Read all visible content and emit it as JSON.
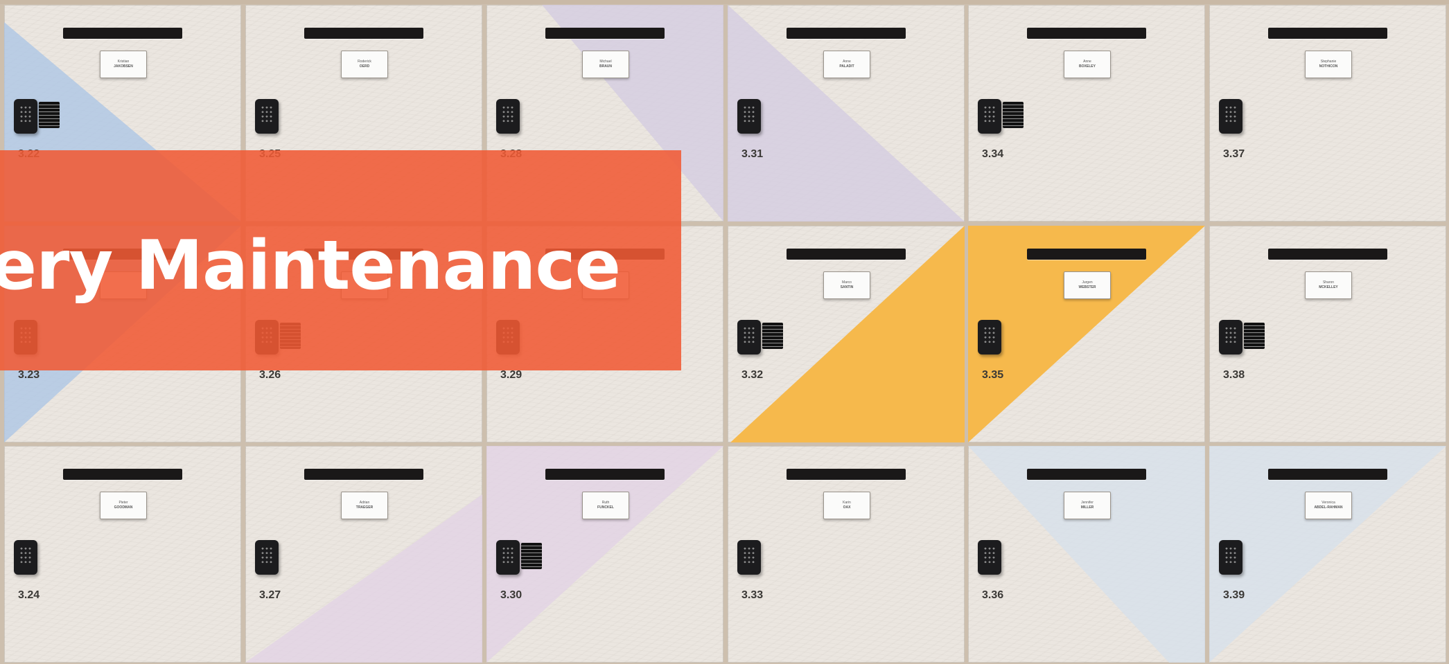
{
  "banner": {
    "title": "tery Maintenance",
    "color": "#f05a34"
  },
  "lockers": [
    {
      "number": "3.22",
      "first": "Kristian",
      "last": "JAKOBSEN",
      "tint": "blue",
      "info": true
    },
    {
      "number": "3.25",
      "first": "Roderick",
      "last": "OERD",
      "tint": "none",
      "info": false
    },
    {
      "number": "3.28",
      "first": "Michael",
      "last": "BRAUN",
      "tint": "lavender",
      "info": false
    },
    {
      "number": "3.31",
      "first": "Anne",
      "last": "PALADIT",
      "tint": "lavender",
      "info": false
    },
    {
      "number": "3.34",
      "first": "Anne",
      "last": "BOXELEY",
      "tint": "none",
      "info": true
    },
    {
      "number": "3.37",
      "first": "Stephanie",
      "last": "NOTHICON",
      "tint": "none",
      "info": false
    },
    {
      "number": "3.23",
      "first": "",
      "last": "",
      "tint": "blue",
      "info": false
    },
    {
      "number": "3.26",
      "first": "",
      "last": "",
      "tint": "none",
      "info": true
    },
    {
      "number": "3.29",
      "first": "",
      "last": "",
      "tint": "none",
      "info": false
    },
    {
      "number": "3.32",
      "first": "Marco",
      "last": "SANTIN",
      "tint": "yellow",
      "info": true
    },
    {
      "number": "3.35",
      "first": "Jurgen",
      "last": "WEBSTER",
      "tint": "yellow",
      "info": false
    },
    {
      "number": "3.38",
      "first": "Sharon",
      "last": "MCKELLEY",
      "tint": "none",
      "info": true
    },
    {
      "number": "3.24",
      "first": "Pieter",
      "last": "GOODMAN",
      "tint": "none",
      "info": false
    },
    {
      "number": "3.27",
      "first": "Adrian",
      "last": "TRAEGER",
      "tint": "pink",
      "info": false
    },
    {
      "number": "3.30",
      "first": "Ruth",
      "last": "FUNCKEL",
      "tint": "pink",
      "info": true
    },
    {
      "number": "3.33",
      "first": "Karin",
      "last": "OAX",
      "tint": "none",
      "info": false
    },
    {
      "number": "3.36",
      "first": "Jennifer",
      "last": "MILLER",
      "tint": "paleblue",
      "info": false
    },
    {
      "number": "3.39",
      "first": "Veronica",
      "last": "ABDEL-RAHMAN",
      "tint": "paleblue",
      "info": false
    }
  ],
  "tint_colors": {
    "blue": "#a9c4e6",
    "lavender": "#d3cbe2",
    "yellow": "#f6b94c",
    "pink": "#e2d2e6",
    "paleblue": "#d5e0ec",
    "none": ""
  }
}
